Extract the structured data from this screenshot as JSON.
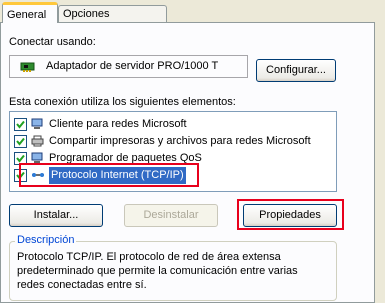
{
  "tabs": [
    {
      "label": "General"
    },
    {
      "label": "Opciones avanzadas"
    }
  ],
  "connect": {
    "label": "Conectar usando:",
    "adapter": "Adaptador de servidor PRO/1000 T",
    "configure_button": "Configurar..."
  },
  "components": {
    "label": "Esta conexión utiliza los siguientes elementos:",
    "items": [
      {
        "label": "Cliente para redes Microsoft",
        "checked": true,
        "icon": "network-client-icon"
      },
      {
        "label": "Compartir impresoras y archivos para redes Microsoft",
        "checked": true,
        "icon": "printer-share-icon"
      },
      {
        "label": "Programador de paquetes QoS",
        "checked": true,
        "icon": "qos-scheduler-icon"
      },
      {
        "label": "Protocolo Internet (TCP/IP)",
        "checked": true,
        "icon": "protocol-icon",
        "selected": true
      }
    ]
  },
  "buttons": {
    "install": "Instalar...",
    "uninstall": "Desinstalar",
    "properties": "Propiedades"
  },
  "description": {
    "title": "Descripción",
    "text": "Protocolo TCP/IP. El protocolo de red de área extensa predeterminado que permite la comunicación entre varias redes conectadas entre sí."
  },
  "colors": {
    "highlight_border": "#e8001c",
    "selection": "#316ac5",
    "group_title": "#0046d5"
  }
}
